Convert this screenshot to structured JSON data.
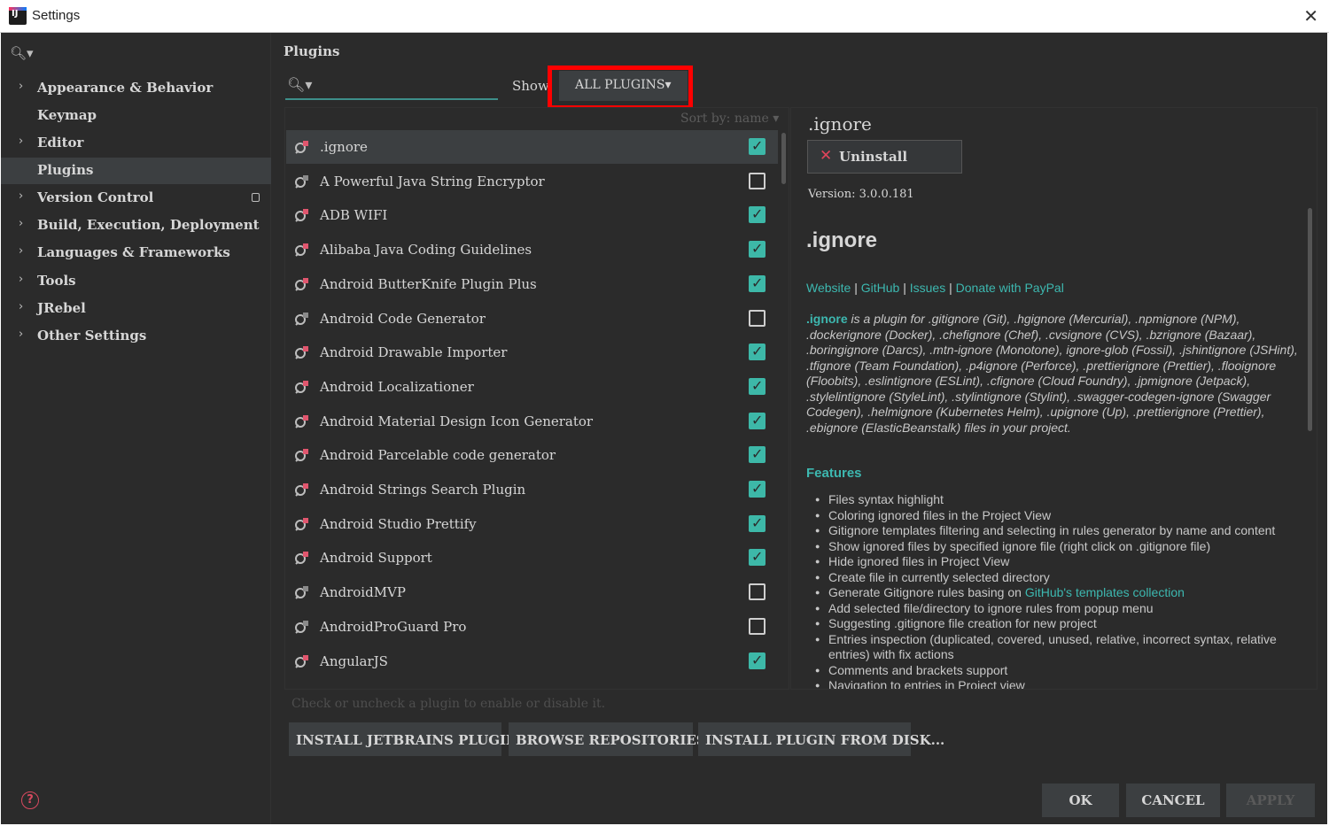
{
  "window": {
    "title": "Settings"
  },
  "sidebar": {
    "items": [
      {
        "label": "Appearance & Behavior",
        "arrow": true
      },
      {
        "label": "Keymap",
        "arrow": false
      },
      {
        "label": "Editor",
        "arrow": true
      },
      {
        "label": "Plugins",
        "arrow": false,
        "selected": true
      },
      {
        "label": "Version Control",
        "arrow": true
      },
      {
        "label": "Build, Execution, Deployment",
        "arrow": true
      },
      {
        "label": "Languages & Frameworks",
        "arrow": true
      },
      {
        "label": "Tools",
        "arrow": true
      },
      {
        "label": "JRebel",
        "arrow": true
      },
      {
        "label": "Other Settings",
        "arrow": true
      }
    ]
  },
  "plugins_panel": {
    "title": "Plugins",
    "show_label": "Show",
    "show_value": "ALL PLUGINS",
    "sort_label": "Sort by: name",
    "hint": "Check or uncheck a plugin to enable or disable it.",
    "list": [
      {
        "name": ".ignore",
        "enabled": true,
        "selected": true
      },
      {
        "name": "A Powerful Java String Encryptor",
        "enabled": false
      },
      {
        "name": "ADB WIFI",
        "enabled": true
      },
      {
        "name": "Alibaba Java Coding Guidelines",
        "enabled": true
      },
      {
        "name": "Android ButterKnife Plugin Plus",
        "enabled": true
      },
      {
        "name": "Android Code Generator",
        "enabled": false
      },
      {
        "name": "Android Drawable Importer",
        "enabled": true
      },
      {
        "name": "Android Localizationer",
        "enabled": true
      },
      {
        "name": "Android Material Design Icon Generator",
        "enabled": true
      },
      {
        "name": "Android Parcelable code generator",
        "enabled": true
      },
      {
        "name": "Android Strings Search Plugin",
        "enabled": true
      },
      {
        "name": "Android Studio Prettify",
        "enabled": true
      },
      {
        "name": "Android Support",
        "enabled": true
      },
      {
        "name": "AndroidMVP",
        "enabled": false
      },
      {
        "name": "AndroidProGuard Pro",
        "enabled": false
      },
      {
        "name": "AngularJS",
        "enabled": true
      }
    ],
    "buttons": {
      "install_jetbrains": "INSTALL JETBRAINS PLUGIN...",
      "browse": "BROWSE REPOSITORIES...",
      "install_disk": "INSTALL PLUGIN FROM DISK..."
    }
  },
  "detail": {
    "title": ".ignore",
    "uninstall": "Uninstall",
    "version": "Version: 3.0.0.181",
    "heading": ".ignore",
    "links": [
      "Website",
      "GitHub",
      "Issues",
      "Donate with PayPal"
    ],
    "desc_lead": ".ignore",
    "desc_text": " is a plugin for .gitignore (Git), .hgignore (Mercurial), .npmignore (NPM), .dockerignore (Docker), .chefignore (Chef), .cvsignore (CVS), .bzrignore (Bazaar), .boringignore (Darcs), .mtn-ignore (Monotone), ignore-glob (Fossil), .jshintignore (JSHint), .tfignore (Team Foundation), .p4ignore (Perforce), .prettierignore (Prettier), .flooignore (Floobits), .eslintignore (ESLint), .cfignore (Cloud Foundry), .jpmignore (Jetpack), .stylelintignore (StyleLint), .stylintignore (Stylint), .swagger-codegen-ignore (Swagger Codegen), .helmignore (Kubernetes Helm), .upignore (Up), .prettierignore (Prettier), .ebignore (ElasticBeanstalk) files in your project.",
    "features_heading": "Features",
    "features": [
      "Files syntax highlight",
      "Coloring ignored files in the Project View",
      "Gitignore templates filtering and selecting in rules generator by name and content",
      "Show ignored files by specified ignore file (right click on .gitignore file)",
      "Hide ignored files in Project View",
      "Create file in currently selected directory",
      "Generate Gitignore rules basing on ",
      "Add selected file/directory to ignore rules from popup menu",
      "Suggesting .gitignore file creation for new project",
      "Entries inspection (duplicated, covered, unused, relative, incorrect syntax, relative entries) with fix actions",
      "Comments and brackets support",
      "Navigation to entries in Project view"
    ],
    "features_link": "GitHub's templates collection"
  },
  "dialog": {
    "ok": "OK",
    "cancel": "CANCEL",
    "apply": "APPLY"
  },
  "colors": {
    "accent": "#3db8a8",
    "highlight": "#ff0000",
    "background": "#2b2b2b"
  }
}
